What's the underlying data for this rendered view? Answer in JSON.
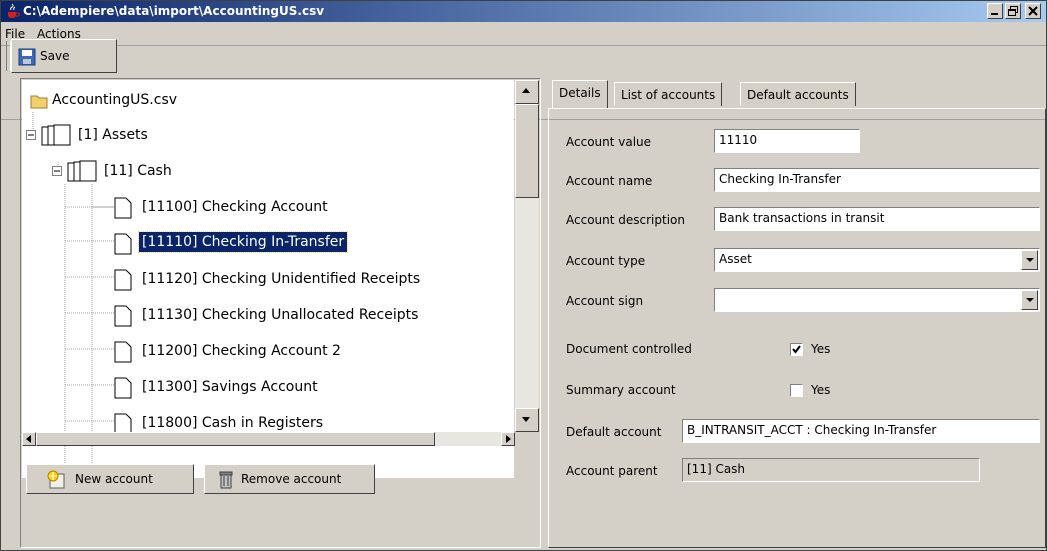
{
  "window": {
    "title": "C:\\Adempiere\\data\\import\\AccountingUS.csv",
    "controls": [
      "minimize-icon",
      "restore-icon",
      "close-icon"
    ]
  },
  "menu": [
    "File",
    "Actions"
  ],
  "toolbar": {
    "save_label": "Save",
    "save_icon": "floppy-disk-icon"
  },
  "tree": {
    "root": "AccountingUS.csv",
    "nodes": [
      "[1] Assets",
      "[11] Cash",
      "[11100] Checking Account",
      "[11110] Checking In-Transfer",
      "[11120] Checking Unidentified Receipts",
      "[11130] Checking Unallocated Receipts",
      "[11200] Checking Account 2",
      "[11300] Savings Account",
      "[11800] Cash in Registers"
    ],
    "selected": "[11110] Checking In-Transfer"
  },
  "buttons": {
    "new_account": "New account",
    "remove_account": "Remove account"
  },
  "tabs": [
    "Details",
    "List of accounts",
    "Default accounts"
  ],
  "active_tab": "Details",
  "form": {
    "account_value_label": "Account value",
    "account_value": "11110",
    "account_name_label": "Account name",
    "account_name": "Checking In-Transfer",
    "account_description_label": "Account description",
    "account_description": "Bank transactions in transit",
    "account_type_label": "Account type",
    "account_type": "Asset",
    "account_sign_label": "Account sign",
    "account_sign": "",
    "document_controlled_label": "Document controlled",
    "document_controlled_yes": "Yes",
    "document_controlled_checked": true,
    "summary_account_label": "Summary account",
    "summary_account_yes": "Yes",
    "summary_account_checked": false,
    "default_account_label": "Default account",
    "default_account": "B_INTRANSIT_ACCT : Checking In-Transfer",
    "account_parent_label": "Account parent",
    "account_parent": "[11] Cash"
  },
  "colors": {
    "title_start": "#0a246a",
    "title_end": "#a6caf0",
    "selection": "#0a246a",
    "face": "#d4d0c8"
  }
}
